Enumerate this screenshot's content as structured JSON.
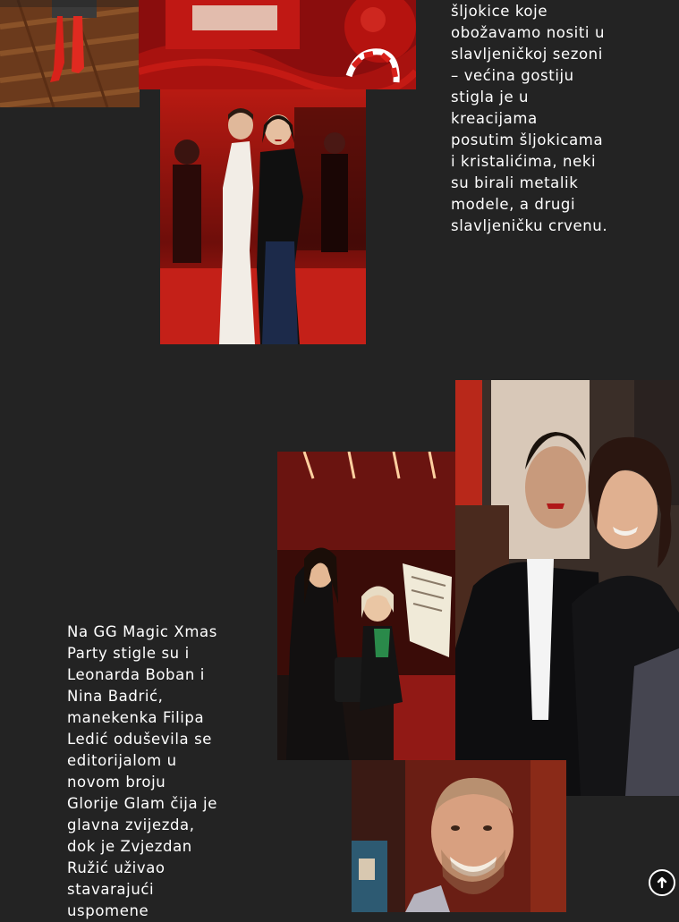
{
  "article": {
    "paragraph_right": "šljokice koje\nobožavamo nositi u\nslavljeničkoj sezoni\n– većina gostiju\nstigla je u\nkreacijama\nposutim šljokicama\ni kristalićima, neki\nsu birali metalik\nmodele, a drugi\nslavljeničku crvenu.",
    "paragraph_left": "Na GG Magic Xmas\nParty stigle su i\nLeonarda Boban i\nNina Badrić,\nmanekenka Filipa\nLedić oduševila se\neditorijalom u\nnovom broju\nGlorije Glam čija je\nglavna zvijezda,\ndok je Zvjezdan\nRužić uživao\nstavarajući\nuspomene"
  },
  "scroll_top": {
    "icon": "arrow-up-circle-icon"
  },
  "colors": {
    "background": "#232323",
    "text": "#ffffff",
    "party_red": "#c8140f"
  }
}
